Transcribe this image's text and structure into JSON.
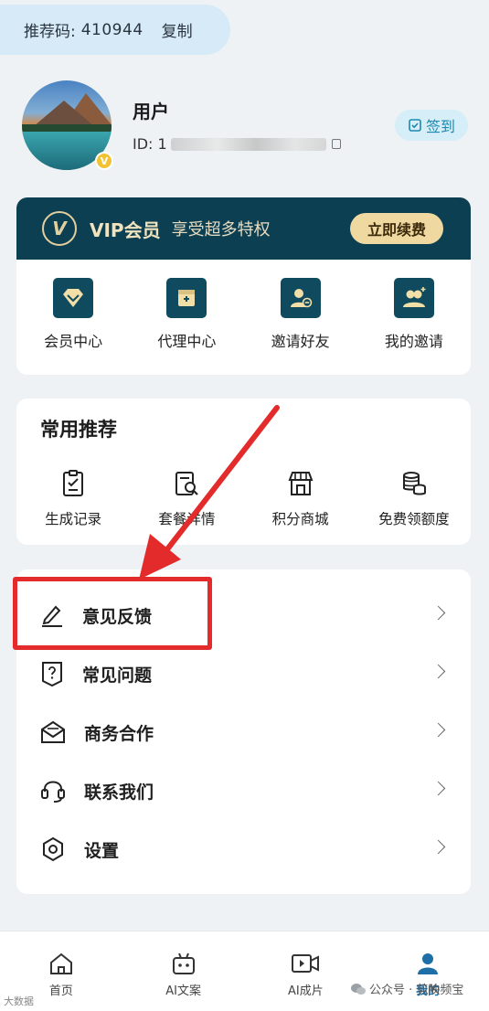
{
  "referral": {
    "label": "推荐码:",
    "code": "410944",
    "copy": "复制"
  },
  "profile": {
    "name": "用户",
    "id_prefix": "ID: 1",
    "checkin": "签到",
    "badge": "V"
  },
  "vip": {
    "logo": "V",
    "title": "VIP会员",
    "subtitle": "享受超多特权",
    "renew": "立即续费",
    "items": [
      {
        "label": "会员中心",
        "icon": "diamond-icon"
      },
      {
        "label": "代理中心",
        "icon": "agent-card-icon"
      },
      {
        "label": "邀请好友",
        "icon": "invite-user-icon"
      },
      {
        "label": "我的邀请",
        "icon": "my-invites-icon"
      }
    ]
  },
  "recommend": {
    "title": "常用推荐",
    "items": [
      {
        "label": "生成记录",
        "icon": "clipboard-icon"
      },
      {
        "label": "套餐详情",
        "icon": "package-search-icon"
      },
      {
        "label": "积分商城",
        "icon": "store-icon"
      },
      {
        "label": "免费领额度",
        "icon": "coins-icon"
      }
    ]
  },
  "menu": [
    {
      "label": "意见反馈",
      "icon": "pen-edit-icon"
    },
    {
      "label": "常见问题",
      "icon": "question-icon"
    },
    {
      "label": "商务合作",
      "icon": "mail-icon"
    },
    {
      "label": "联系我们",
      "icon": "headset-icon"
    },
    {
      "label": "设置",
      "icon": "settings-icon"
    }
  ],
  "nav": [
    {
      "label": "首页",
      "icon": "home-icon"
    },
    {
      "label": "AI文案",
      "icon": "robot-icon"
    },
    {
      "label": "AI成片",
      "icon": "video-icon"
    },
    {
      "label": "我的",
      "icon": "user-icon",
      "active": true
    }
  ],
  "watermark": {
    "text": "公众号 · 剪映频宝",
    "left": "大数据"
  },
  "colors": {
    "primary": "#0d3f52",
    "accent": "#1e6fa8",
    "highlight": "#e32b2b",
    "gold": "#f0d9a0"
  }
}
